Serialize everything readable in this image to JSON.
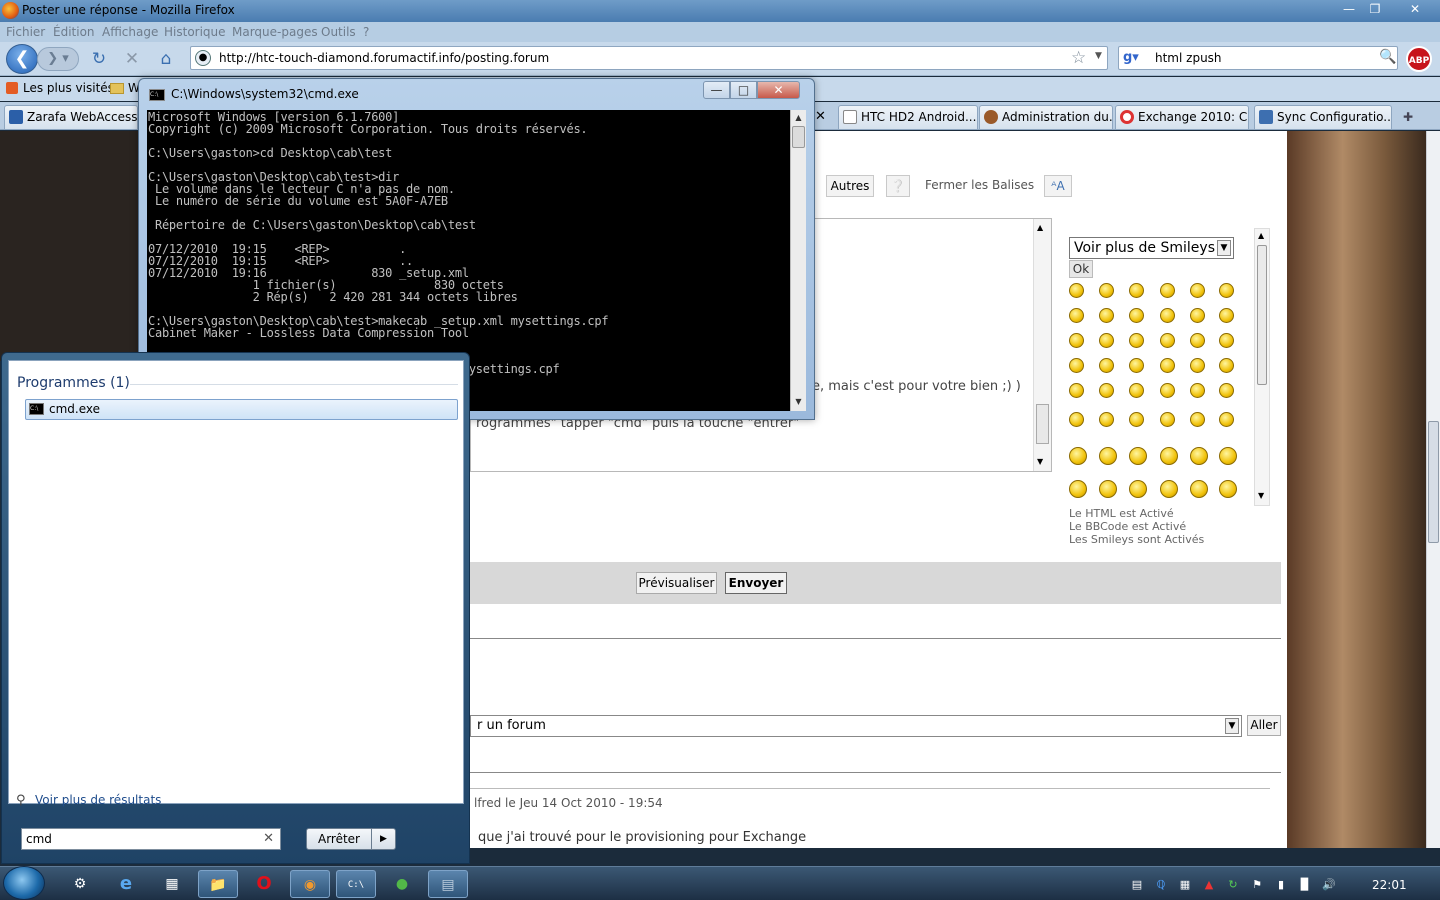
{
  "browser": {
    "title": "Poster une réponse - Mozilla Firefox",
    "menu": [
      "Fichier",
      "Édition",
      "Affichage",
      "Historique",
      "Marque-pages",
      "Outils",
      "?"
    ],
    "url": "http://htc-touch-diamond.forumactif.info/posting.forum",
    "search_text": "html zpush",
    "abp_label": "ABP"
  },
  "bookmarks": {
    "most_visited": "Les plus visités",
    "w_folder": "W",
    "zarafa": "Zarafa WebAccess"
  },
  "tabs": [
    "HTC HD2 Android...",
    "Administration du...",
    "Exchange 2010: C...",
    "Sync Configuratio..."
  ],
  "editor": {
    "autres_label": "Autres",
    "fermer_balises_label": "Fermer les Balises",
    "text_line1": "e, mais c'est pour votre bien ;) )",
    "text_line2": "rogrammes\" tapper \"cmd\" puis la touche \"entrer\"",
    "smiley_select": "Voir plus de Smileys",
    "ok_label": "Ok",
    "html_status": "Le HTML est Activé",
    "bbcode_status": "Le BBCode est Activé",
    "smileys_status": "Les Smileys sont Activés",
    "preview_label": "Prévisualiser",
    "send_label": "Envoyer",
    "jump_select": "r un forum",
    "go_label": "Aller",
    "post_meta": "lfred le Jeu 14 Oct 2010 - 19:54",
    "post_text": "que j'ai trouvé pour le provisioning pour Exchange"
  },
  "cmd": {
    "title": "C:\\Windows\\system32\\cmd.exe",
    "output": "Microsoft Windows [version 6.1.7600]\nCopyright (c) 2009 Microsoft Corporation. Tous droits réservés.\n\nC:\\Users\\gaston>cd Desktop\\cab\\test\n\nC:\\Users\\gaston\\Desktop\\cab\\test>dir\n Le volume dans le lecteur C n'a pas de nom.\n Le numéro de série du volume est 5A0F-A7EB\n\n Répertoire de C:\\Users\\gaston\\Desktop\\cab\\test\n\n07/12/2010  19:15    <REP>          .\n07/12/2010  19:15    <REP>          ..\n07/12/2010  19:16               830 _setup.xml\n               1 fichier(s)              830 octets\n               2 Rép(s)   2 420 281 344 octets libres\n\nC:\\Users\\gaston\\Desktop\\cab\\test>makecab _setup.xml mysettings.cpf\nCabinet Maker - Lossless Data Compression Tool\n\n\n                                  _setup.xml mysettings.cpf\n                                  n Tool"
  },
  "start_menu": {
    "heading": "Programmes (1)",
    "result": "cmd.exe",
    "more_results": "Voir plus de résultats",
    "search_value": "cmd",
    "shutdown_label": "Arrêter"
  },
  "taskbar": {
    "clock": "22:01"
  }
}
